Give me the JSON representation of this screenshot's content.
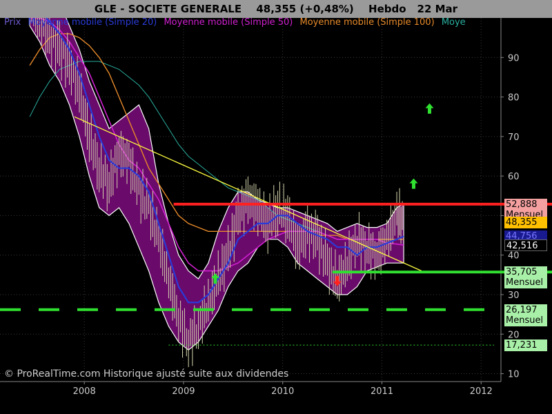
{
  "header": {
    "symbol": "GLE - SOCIETE GENERALE",
    "quote": "48,355 (+0,48%)",
    "period": "Hebdo",
    "date": "22 Mar"
  },
  "legend": [
    {
      "label": "Prix",
      "color": "#6a5acd"
    },
    {
      "label": "Moyenne mobile (Simple 20)",
      "color": "#2a3bd8"
    },
    {
      "label": "Moyenne mobile (Simple 50)",
      "color": "#d01fd0"
    },
    {
      "label": "Moyenne mobile (Simple 100)",
      "color": "#e88a2a"
    },
    {
      "label": "Moye",
      "color": "#2ab0a0"
    }
  ],
  "copyright": "© ProRealTime.com Historique ajusté suite aux dividendes",
  "price_tags": [
    {
      "value": "52,888",
      "sub": "Mensuel",
      "bg": "#f4a0a0",
      "y": 52.888
    },
    {
      "value": "48,355",
      "sub": "",
      "bg": "#ffc000",
      "y": 48.355
    },
    {
      "value": "44,756",
      "sub": "",
      "bg": "#1a1a90",
      "y": 44.756
    },
    {
      "value": "42,516",
      "sub": "",
      "bg": "#000000",
      "y": 42.516
    },
    {
      "value": "35,705",
      "sub": "Mensuel",
      "bg": "#a8f0a8",
      "y": 35.705
    },
    {
      "value": "26,197",
      "sub": "Mensuel",
      "bg": "#a8f0a8",
      "y": 26.197
    },
    {
      "value": "17,231",
      "sub": "",
      "bg": "#a8f0a8",
      "y": 17.231
    }
  ],
  "chart_data": {
    "type": "line",
    "title": "GLE - SOCIETE GENERALE",
    "x_ticks": [
      "2008",
      "2009",
      "2010",
      "2011",
      "2012"
    ],
    "x_tick_values": [
      2008,
      2009,
      2010,
      2011,
      2012
    ],
    "y_ticks": [
      10,
      20,
      30,
      40,
      50,
      60,
      70,
      80,
      90
    ],
    "xlim": [
      2007.15,
      2012.2
    ],
    "ylim": [
      8,
      100
    ],
    "grid": true,
    "price": {
      "x": [
        2007.45,
        2007.55,
        2007.65,
        2007.75,
        2007.85,
        2007.95,
        2008.05,
        2008.15,
        2008.25,
        2008.35,
        2008.45,
        2008.55,
        2008.65,
        2008.75,
        2008.85,
        2008.95,
        2009.05,
        2009.15,
        2009.25,
        2009.35,
        2009.45,
        2009.55,
        2009.65,
        2009.75,
        2009.85,
        2009.95,
        2010.05,
        2010.15,
        2010.25,
        2010.35,
        2010.45,
        2010.55,
        2010.65,
        2010.75,
        2010.85,
        2010.95,
        2011.05,
        2011.15,
        2011.22
      ],
      "y": [
        104,
        100,
        95,
        92,
        88,
        82,
        70,
        62,
        58,
        66,
        64,
        56,
        52,
        44,
        34,
        24,
        18,
        22,
        28,
        34,
        40,
        50,
        54,
        52,
        48,
        52,
        50,
        42,
        46,
        44,
        38,
        33,
        38,
        44,
        42,
        40,
        44,
        50,
        48.355
      ]
    },
    "bands": {
      "upper": [
        110,
        108,
        106,
        104,
        98,
        92,
        84,
        78,
        72,
        74,
        76,
        78,
        72,
        58,
        48,
        40,
        36,
        34,
        38,
        46,
        52,
        56,
        56,
        54,
        53,
        52,
        52,
        51,
        50,
        49,
        48,
        46,
        47,
        48,
        47,
        47,
        48,
        52,
        53
      ],
      "lower": [
        98,
        94,
        88,
        84,
        78,
        70,
        60,
        52,
        50,
        52,
        48,
        42,
        36,
        28,
        22,
        18,
        16,
        18,
        22,
        26,
        32,
        36,
        38,
        42,
        44,
        44,
        42,
        38,
        36,
        34,
        32,
        30,
        30,
        32,
        36,
        37,
        38,
        38,
        38
      ]
    },
    "series": [
      {
        "name": "Moyenne mobile (Simple 20)",
        "color": "#2a3bd8",
        "y": [
          104,
          102,
          99,
          96,
          92,
          86,
          78,
          70,
          64,
          62,
          62,
          60,
          56,
          48,
          40,
          32,
          28,
          28,
          30,
          34,
          38,
          44,
          46,
          48,
          48,
          50,
          50,
          48,
          46,
          45,
          44,
          42,
          42,
          40,
          42,
          42,
          43,
          44,
          44.756
        ]
      },
      {
        "name": "Moyenne mobile (Simple 50)",
        "color": "#d01fd0",
        "y": [
          100,
          100,
          99,
          97,
          94,
          90,
          86,
          80,
          74,
          68,
          64,
          62,
          58,
          54,
          48,
          42,
          38,
          36,
          36,
          36,
          37,
          38,
          40,
          42,
          44,
          45,
          46,
          46,
          46,
          46,
          45,
          44,
          44,
          44,
          44,
          44,
          43,
          42.8,
          42.516
        ]
      },
      {
        "name": "Moyenne mobile (Simple 100)",
        "color": "#e88a2a",
        "y": [
          88,
          92,
          95,
          96,
          96,
          95,
          93,
          90,
          86,
          80,
          74,
          68,
          62,
          58,
          54,
          50,
          48,
          47,
          46,
          46,
          46,
          46,
          46,
          46,
          46,
          46,
          46,
          46,
          46,
          45,
          45,
          45,
          44,
          44,
          44,
          44,
          44,
          44,
          44
        ]
      },
      {
        "name": "Moye",
        "color": "#2ab0a0",
        "y": [
          75,
          80,
          84,
          87,
          88,
          89,
          89,
          89,
          88,
          87,
          85,
          83,
          80,
          76,
          72,
          68,
          65,
          63,
          61,
          59,
          57,
          56,
          55,
          54,
          52,
          50,
          49,
          48,
          47,
          46,
          45,
          44,
          44,
          44,
          44,
          44,
          44,
          44,
          44
        ]
      }
    ],
    "trendline": {
      "x": [
        2007.9,
        2011.4
      ],
      "y": [
        75,
        36
      ],
      "color": "#ffff40"
    },
    "hlines": [
      {
        "y": 52.888,
        "x_from": 2008.9,
        "color": "#ff2020",
        "style": "solid"
      },
      {
        "y": 35.705,
        "x_from": 2010.5,
        "color": "#30e030",
        "style": "solid"
      },
      {
        "y": 26.197,
        "x_from": 2007.15,
        "color": "#30e030",
        "style": "dashed"
      },
      {
        "y": 17.231,
        "x_from": 2008.85,
        "color": "#30e030",
        "style": "dotted"
      }
    ],
    "signals": [
      {
        "x": 2011.48,
        "y": 77,
        "dir": "up",
        "color": "#30e030"
      },
      {
        "x": 2011.32,
        "y": 58,
        "dir": "up",
        "color": "#30e030"
      },
      {
        "x": 2009.32,
        "y": 34,
        "dir": "up",
        "color": "#30e030"
      },
      {
        "x": 2010.55,
        "y": 33.5,
        "dir": "down",
        "color": "#ff2020"
      }
    ]
  }
}
